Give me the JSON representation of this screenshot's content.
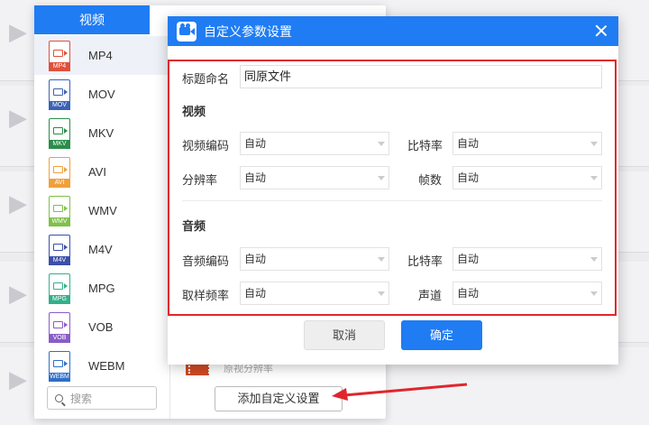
{
  "format_panel": {
    "tab_label": "视频",
    "formats": [
      {
        "name": "MP4",
        "tag": "MP4",
        "color": "#e0503a",
        "active": true
      },
      {
        "name": "MOV",
        "tag": "MOV",
        "color": "#3b63b3"
      },
      {
        "name": "MKV",
        "tag": "MKV",
        "color": "#2a8d4a"
      },
      {
        "name": "AVI",
        "tag": "AVI",
        "color": "#f0a03a"
      },
      {
        "name": "WMV",
        "tag": "WMV",
        "color": "#7fc04a"
      },
      {
        "name": "M4V",
        "tag": "M4V",
        "color": "#3b4fa8"
      },
      {
        "name": "MPG",
        "tag": "MPG",
        "color": "#33b08a"
      },
      {
        "name": "VOB",
        "tag": "VOB",
        "color": "#8a5cc8"
      },
      {
        "name": "WEBM",
        "tag": "WEBM",
        "color": "#2f6fc8"
      }
    ],
    "search_placeholder": "搜索",
    "preset_text": "原视分辨率",
    "add_custom_label": "添加自定义设置"
  },
  "dialog": {
    "title": "自定义参数设置",
    "title_naming_label": "标题命名",
    "title_naming_value": "同原文件",
    "video_section": "视频",
    "audio_section": "音频",
    "video": {
      "codec_label": "视频编码",
      "codec_value": "自动",
      "bitrate_label": "比特率",
      "bitrate_value": "自动",
      "resolution_label": "分辨率",
      "resolution_value": "自动",
      "framerate_label": "帧数",
      "framerate_value": "自动"
    },
    "audio": {
      "codec_label": "音频编码",
      "codec_value": "自动",
      "bitrate_label": "比特率",
      "bitrate_value": "自动",
      "samplerate_label": "取样频率",
      "samplerate_value": "自动",
      "channel_label": "声道",
      "channel_value": "自动"
    },
    "cancel_label": "取消",
    "ok_label": "确定"
  },
  "colors": {
    "accent": "#1f7cf3",
    "highlight": "#e0262d"
  }
}
